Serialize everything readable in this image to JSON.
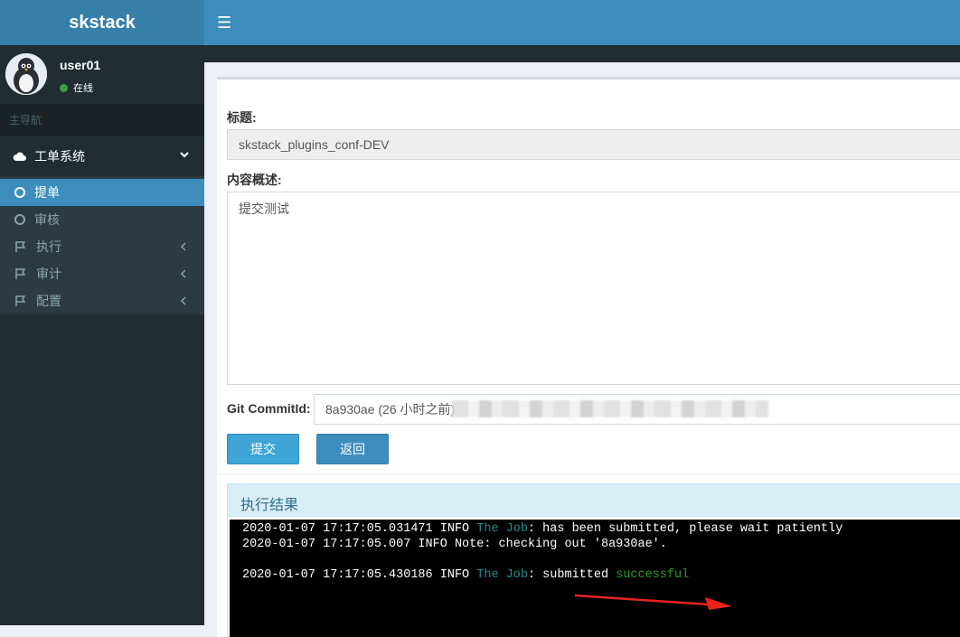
{
  "brand": {
    "name": "skstack"
  },
  "user": {
    "name": "user01",
    "status": "在线"
  },
  "nav": {
    "header": "主导航",
    "root": {
      "label": "工单系统"
    },
    "items": [
      {
        "label": "提单"
      },
      {
        "label": "审核"
      },
      {
        "label": "执行"
      },
      {
        "label": "审计"
      },
      {
        "label": "配置"
      }
    ]
  },
  "form": {
    "title_label": "标题:",
    "title_value": "skstack_plugins_conf-DEV",
    "desc_label": "内容概述:",
    "desc_value": "提交测试",
    "commit_label": "Git CommitId:",
    "commit_value": "8a930ae (26 小时之前)",
    "submit_label": "提交",
    "back_label": "返回"
  },
  "result": {
    "header": "执行结果",
    "log1_prefix": "2020-01-07 17:17:05.031471 INFO ",
    "log1_job": "The Job",
    "log1_suffix": ": has been submitted, please wait patiently",
    "log2": "2020-01-07 17:17:05.007 INFO Note: checking out '8a930ae'.",
    "log3_prefix": "2020-01-07 17:17:05.430186 INFO ",
    "log3_job": "The Job",
    "log3_mid": ": submitted ",
    "log3_status": "successful"
  },
  "colors": {
    "navbar": "#3c8dbc",
    "logo": "#367fa9",
    "sidebar": "#222d32",
    "accent": "#3c8dbc"
  }
}
